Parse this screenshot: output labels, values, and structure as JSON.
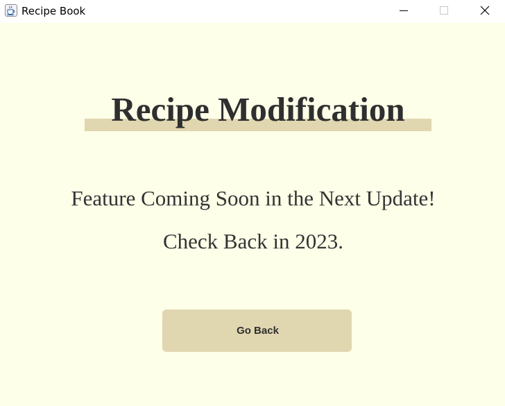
{
  "window": {
    "title": "Recipe Book",
    "app_icon": "java-cup-icon",
    "controls": [
      "minimize-icon",
      "maximize-icon",
      "close-icon"
    ]
  },
  "page": {
    "heading": "Recipe Modification",
    "message_line_1": "Feature Coming Soon in the Next Update!",
    "message_line_2": "Check Back in 2023.",
    "go_back_label": "Go Back"
  },
  "colors": {
    "background": "#fdffe8",
    "accent": "#e0d6b0",
    "text": "#2f2f2f",
    "titlebar": "#ffffff"
  }
}
